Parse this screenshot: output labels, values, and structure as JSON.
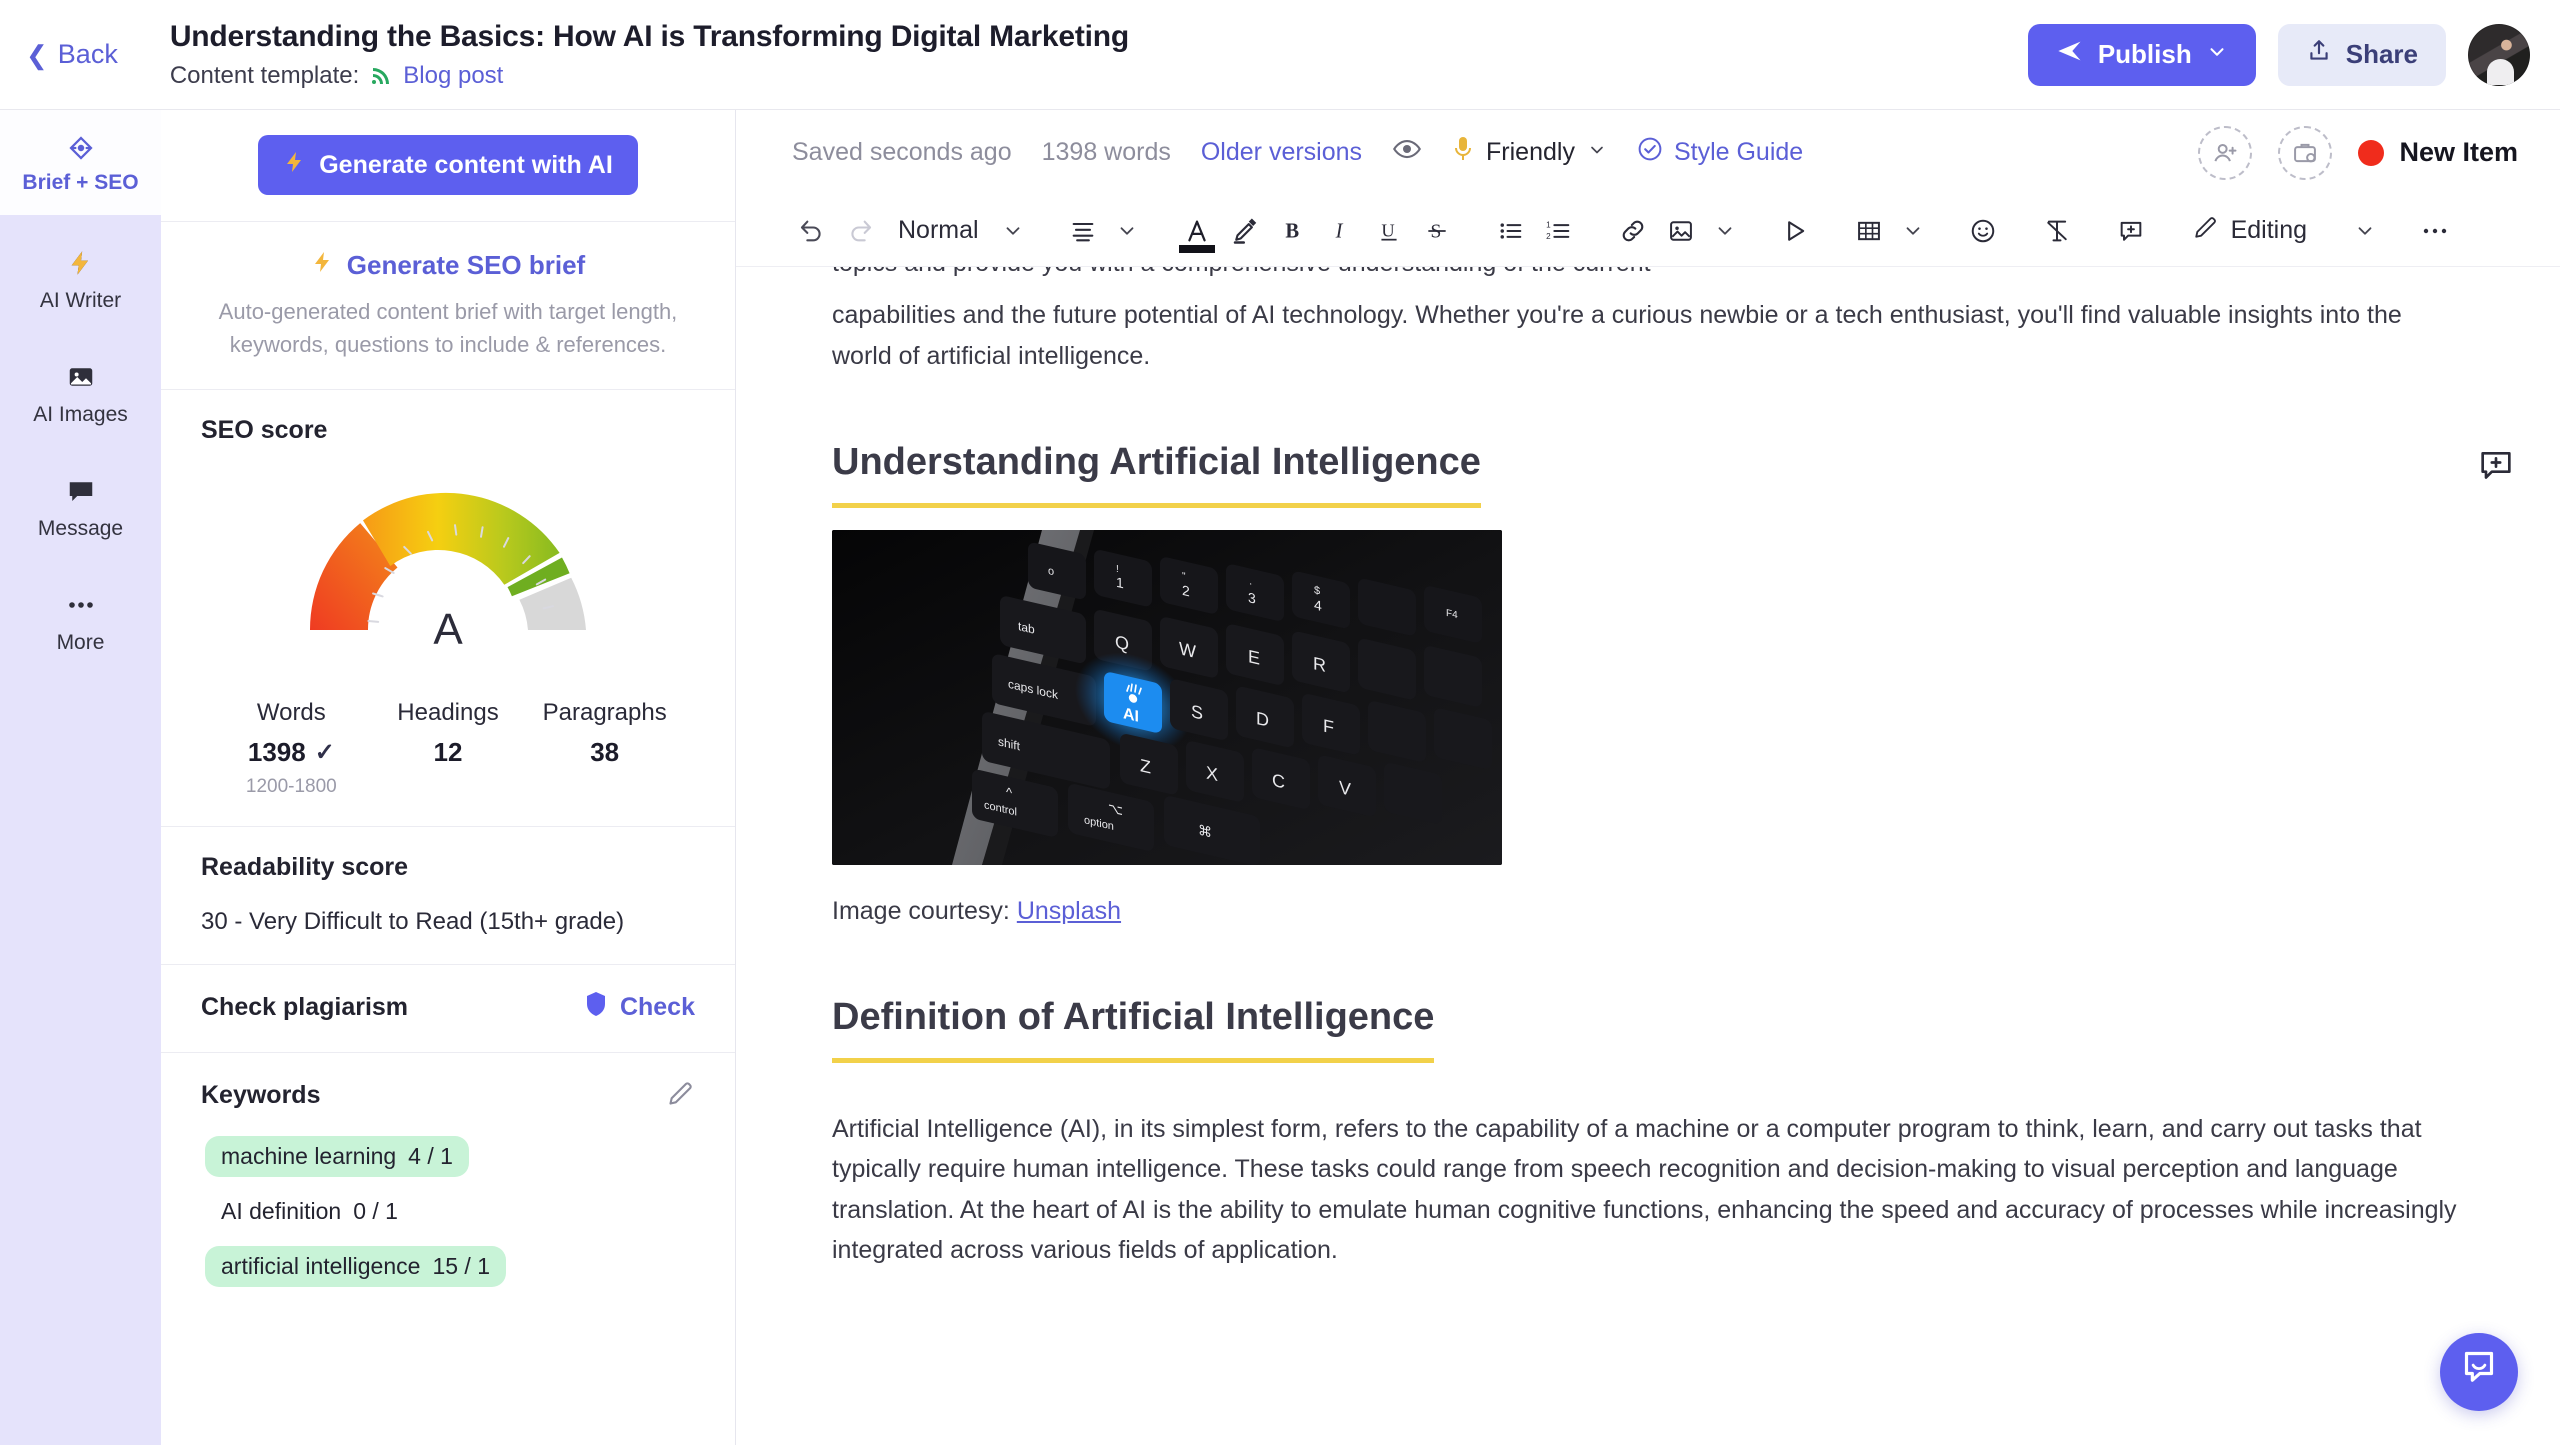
{
  "topbar": {
    "back_label": "Back",
    "doc_title": "Understanding the Basics: How AI is Transforming Digital Marketing",
    "template_label": "Content template:",
    "template_name": "Blog post",
    "publish_label": "Publish",
    "share_label": "Share"
  },
  "rail": {
    "items": [
      {
        "label": "Brief + SEO",
        "icon": "target-icon"
      },
      {
        "label": "AI Writer",
        "icon": "lightning-icon"
      },
      {
        "label": "AI Images",
        "icon": "image-icon"
      },
      {
        "label": "Message",
        "icon": "chat-icon"
      },
      {
        "label": "More",
        "icon": "ellipsis-icon"
      }
    ]
  },
  "panel": {
    "generate_button": "Generate content with AI",
    "seo_brief_link": "Generate SEO brief",
    "seo_brief_sub": "Auto-generated content brief with target length, keywords, questions to include & references.",
    "seo_score_title": "SEO score",
    "grade": "A",
    "stats": [
      {
        "label": "Words",
        "value": "1398",
        "range": "1200-1800",
        "checked": true
      },
      {
        "label": "Headings",
        "value": "12",
        "range": "",
        "checked": false
      },
      {
        "label": "Paragraphs",
        "value": "38",
        "range": "",
        "checked": false
      }
    ],
    "readability_title": "Readability score",
    "readability_value": "30 - Very Difficult to Read (15th+ grade)",
    "plagiarism_title": "Check plagiarism",
    "plagiarism_action": "Check",
    "keywords_title": "Keywords",
    "keywords": [
      {
        "term": "machine learning",
        "count": "4 / 1",
        "hit": true
      },
      {
        "term": "AI definition",
        "count": "0 / 1",
        "hit": false
      },
      {
        "term": "artificial intelligence",
        "count": "15 / 1",
        "hit": true
      }
    ]
  },
  "editor": {
    "status": {
      "saved": "Saved seconds ago",
      "words": "1398 words",
      "older_versions": "Older versions",
      "tone": "Friendly",
      "style_guide": "Style Guide",
      "new_item": "New Item"
    },
    "toolbar": {
      "block_format": "Normal",
      "mode": "Editing"
    },
    "content": {
      "clipped_line": "topics and provide you with a comprehensive understanding of the current",
      "para_intro": "capabilities and the future potential of AI technology. Whether you're a curious newbie or a tech enthusiast, you'll find valuable insights into the world of artificial intelligence.",
      "heading_1": "Understanding Artificial Intelligence",
      "image_caption_prefix": "Image courtesy:",
      "image_caption_link": "Unsplash",
      "heading_2": "Definition of Artificial Intelligence",
      "para_body": "Artificial Intelligence (AI), in its simplest form, refers to the capability of a machine or a computer program to think, learn, and carry out tasks that typically require human intelligence. These tasks could range from speech recognition and decision-making to visual perception and language translation. At the heart of AI is the ability to emulate human cognitive functions, enhancing the speed and accuracy of processes while increasingly integrated across various fields of application."
    },
    "image_keys": {
      "row_num": [
        "o",
        "1",
        "2",
        "3",
        "4"
      ],
      "row_tab": [
        "tab",
        "Q",
        "W",
        "E",
        "R"
      ],
      "row_caps": [
        "caps lock",
        "AI",
        "S",
        "D",
        "F"
      ],
      "row_shift": [
        "shift",
        "Z",
        "X",
        "C",
        "V"
      ],
      "row_ctrl": [
        "control",
        "option"
      ]
    }
  },
  "colors": {
    "accent": "#5d5fef",
    "highlight": "#f2d14a",
    "status_red": "#f02c1c",
    "keyword_hit": "#c8f3d7"
  }
}
